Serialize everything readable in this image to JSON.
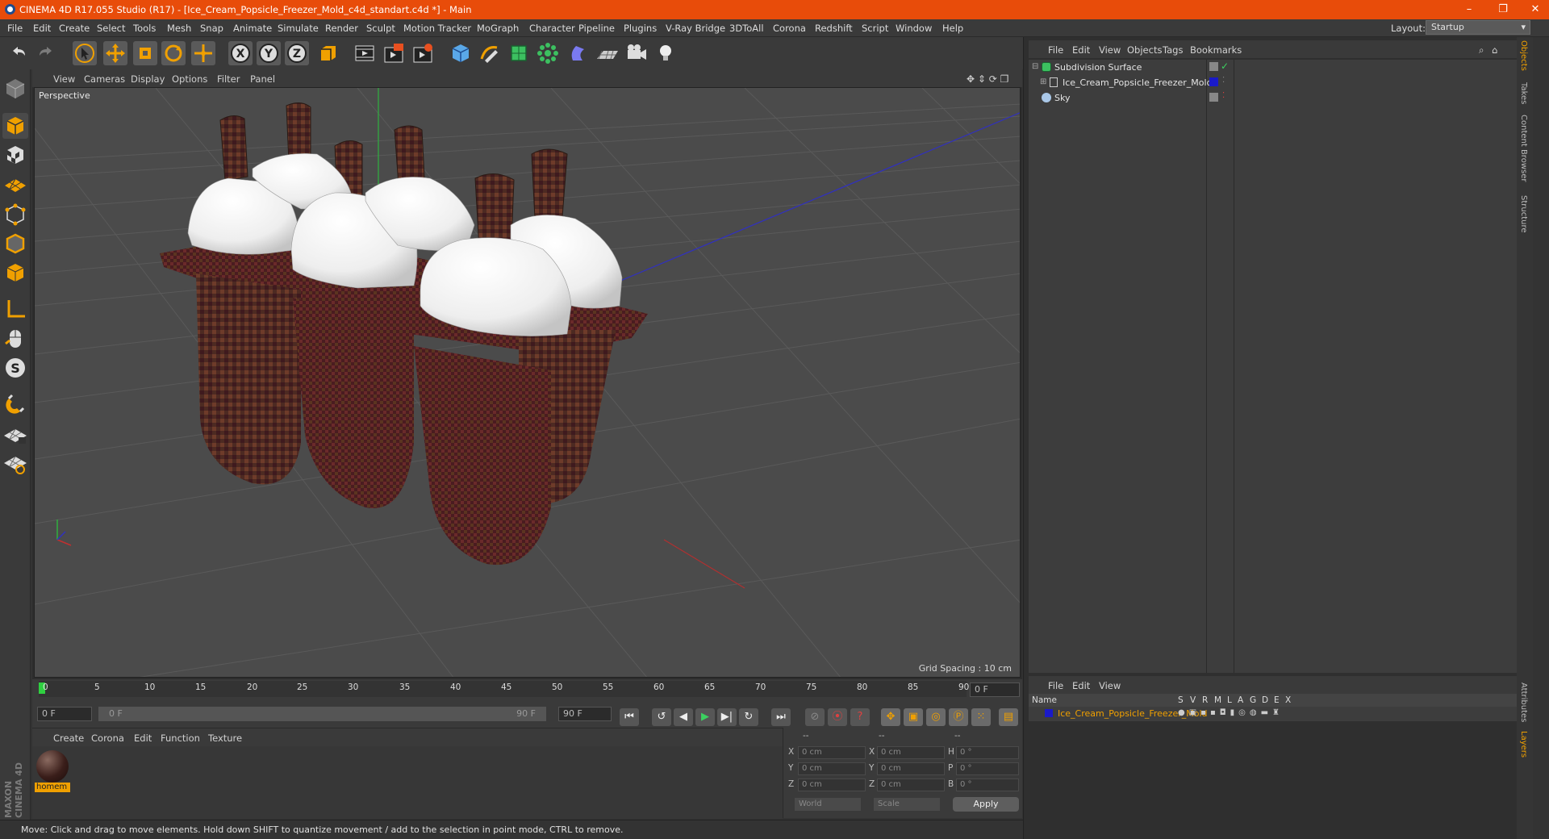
{
  "window": {
    "title": "CINEMA 4D R17.055 Studio (R17) - [Ice_Cream_Popsicle_Freezer_Mold_c4d_standart.c4d *] - Main",
    "controls": [
      "–",
      "❐",
      "✕"
    ]
  },
  "menubar": {
    "items": [
      "File",
      "Edit",
      "Create",
      "Select",
      "Tools",
      "Mesh",
      "Snap",
      "Animate",
      "Simulate",
      "Render",
      "Sculpt",
      "Motion Tracker",
      "MoGraph",
      "Character",
      "Pipeline",
      "Plugins",
      "V-Ray Bridge",
      "3DToAll",
      "Corona",
      "Redshift",
      "Script",
      "Window",
      "Help"
    ],
    "layout_label": "Layout:",
    "layout_value": "Startup"
  },
  "toolbar": {
    "icons": [
      "undo-icon",
      "redo-icon",
      "select-arrow-icon",
      "move-icon",
      "scale-icon",
      "rotate-icon",
      "move-axis-icon",
      "x-axis-lock-icon",
      "y-axis-lock-icon",
      "z-axis-lock-icon",
      "world-coordinates-icon",
      "render-view-icon",
      "render-picture-viewer-icon",
      "edit-render-settings-icon",
      "cube-primitive-icon",
      "pen-spline-icon",
      "subdivision-icon",
      "array-icon",
      "deformer-icon",
      "floor-icon",
      "camera-icon",
      "light-icon"
    ],
    "axis_labels": [
      "X",
      "Y",
      "Z"
    ]
  },
  "left_tools": [
    "make-editable-icon",
    "model-mode-icon",
    "texture-mode-icon",
    "workplane-icon",
    "points-mode-icon",
    "edges-mode-icon",
    "polygons-mode-icon",
    "axis-mode-icon",
    "tweak-icon",
    "snap-s-icon",
    "magnet-icon",
    "lock-workplane-icon",
    "grid-snap-icon"
  ],
  "viewport": {
    "menu": [
      "View",
      "Cameras",
      "Display",
      "Options",
      "Filter",
      "Panel"
    ],
    "label": "Perspective",
    "grid_spacing": "Grid Spacing : 10 cm"
  },
  "timeline": {
    "ticks": [
      "0",
      "5",
      "10",
      "15",
      "20",
      "25",
      "30",
      "35",
      "40",
      "45",
      "50",
      "55",
      "60",
      "65",
      "70",
      "75",
      "80",
      "85",
      "90"
    ],
    "current_frame": "0 F",
    "start_field": "0 F",
    "range_start": "0 F",
    "range_end": "90 F",
    "end_field": "90 F"
  },
  "material_panel": {
    "menu": [
      "Create",
      "Corona",
      "Edit",
      "Function",
      "Texture"
    ],
    "material_name": "homem"
  },
  "coordinates": {
    "headers": [
      "--",
      "--",
      "--"
    ],
    "rows": [
      {
        "a": "X",
        "av": "0 cm",
        "b": "X",
        "bv": "0 cm",
        "c": "H",
        "cv": "0 °"
      },
      {
        "a": "Y",
        "av": "0 cm",
        "b": "Y",
        "bv": "0 cm",
        "c": "P",
        "cv": "0 °"
      },
      {
        "a": "Z",
        "av": "0 cm",
        "b": "Z",
        "bv": "0 cm",
        "c": "B",
        "cv": "0 °"
      }
    ],
    "world": "World",
    "scale": "Scale",
    "apply": "Apply"
  },
  "status": "Move: Click and drag to move elements. Hold down SHIFT to quantize movement / add to the selection in point mode, CTRL to remove.",
  "object_manager": {
    "menu": [
      "File",
      "Edit",
      "View",
      "Objects",
      "Tags",
      "Bookmarks"
    ],
    "objects": [
      {
        "name": "Subdivision Surface"
      },
      {
        "name": "Ice_Cream_Popsicle_Freezer_Mold"
      },
      {
        "name": "Sky"
      }
    ]
  },
  "layer_manager": {
    "menu": [
      "File",
      "Edit",
      "View"
    ],
    "columns": [
      "Name",
      "S",
      "V",
      "R",
      "M",
      "L",
      "A",
      "G",
      "D",
      "E",
      "X"
    ],
    "layer_name": "Ice_Cream_Popsicle_Freezer_Mold"
  },
  "side_tabs": [
    "Objects",
    "Takes",
    "Content Browser",
    "Structure",
    "Attributes",
    "Layers"
  ],
  "brand": "MAXON CINEMA 4D",
  "colors": {
    "titlebar": "#e84c0a",
    "accent_orange": "#f0a000",
    "layer_blue": "#1a1ac8",
    "viewport_bg": "#4b4b4b",
    "mold_maroon": "#5a1f24",
    "ice_white": "#f2f2f2"
  }
}
